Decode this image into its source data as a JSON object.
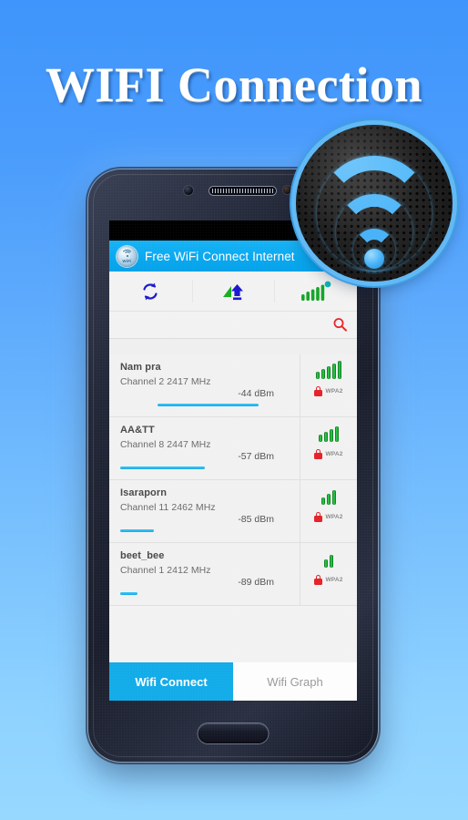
{
  "hero": {
    "title": "WIFI Connection"
  },
  "colors": {
    "bg_top": "#3f95fb",
    "bg_bottom": "#97d8ff",
    "accent_blue": "#13ace9",
    "appbar_blue": "#0aa8ef",
    "signal_green": "#2fd14b",
    "lock_red": "#e4232a",
    "search_red": "#e8272d",
    "progress_blue": "#17a8e8"
  },
  "phone": {
    "statusbar": {
      "signal_icon": "cellular-signal-icon"
    },
    "appbar": {
      "app_icon": "wifi-circle-icon",
      "app_icon_label": "WiFi",
      "title": "Free WiFi Connect Internet"
    },
    "toolbar": {
      "items": [
        {
          "name": "refresh-icon",
          "label": "refresh"
        },
        {
          "name": "upload-icon",
          "label": "upload"
        },
        {
          "name": "signal-strength-icon",
          "label": "signal"
        }
      ]
    },
    "searchbar": {
      "icon": "search-icon"
    },
    "list": {
      "rows": [
        {
          "ssid": "Nam pra",
          "channel": "Channel 2 2417 MHz",
          "dbm": "-44 dBm",
          "bars": 5,
          "security": "WPA2",
          "bar_left_pct": 22,
          "bar_width_pct": 60
        },
        {
          "ssid": "AA&TT",
          "channel": "Channel 8 2447 MHz",
          "dbm": "-57 dBm",
          "bars": 4,
          "security": "WPA2",
          "bar_left_pct": 0,
          "bar_width_pct": 50
        },
        {
          "ssid": "Isaraporn",
          "channel": "Channel 11 2462 MHz",
          "dbm": "-85 dBm",
          "bars": 3,
          "security": "WPA2",
          "bar_left_pct": 0,
          "bar_width_pct": 20
        },
        {
          "ssid": "beet_bee",
          "channel": "Channel 1 2412 MHz",
          "dbm": "-89 dBm",
          "bars": 2,
          "security": "WPA2",
          "bar_left_pct": 0,
          "bar_width_pct": 10
        }
      ]
    },
    "tabs": [
      {
        "label": "Wifi Connect",
        "active": true
      },
      {
        "label": "Wifi Graph",
        "active": false
      }
    ],
    "home_button": "home-button"
  },
  "badge": {
    "name": "wifi-signal-badge",
    "arcs": 3
  }
}
